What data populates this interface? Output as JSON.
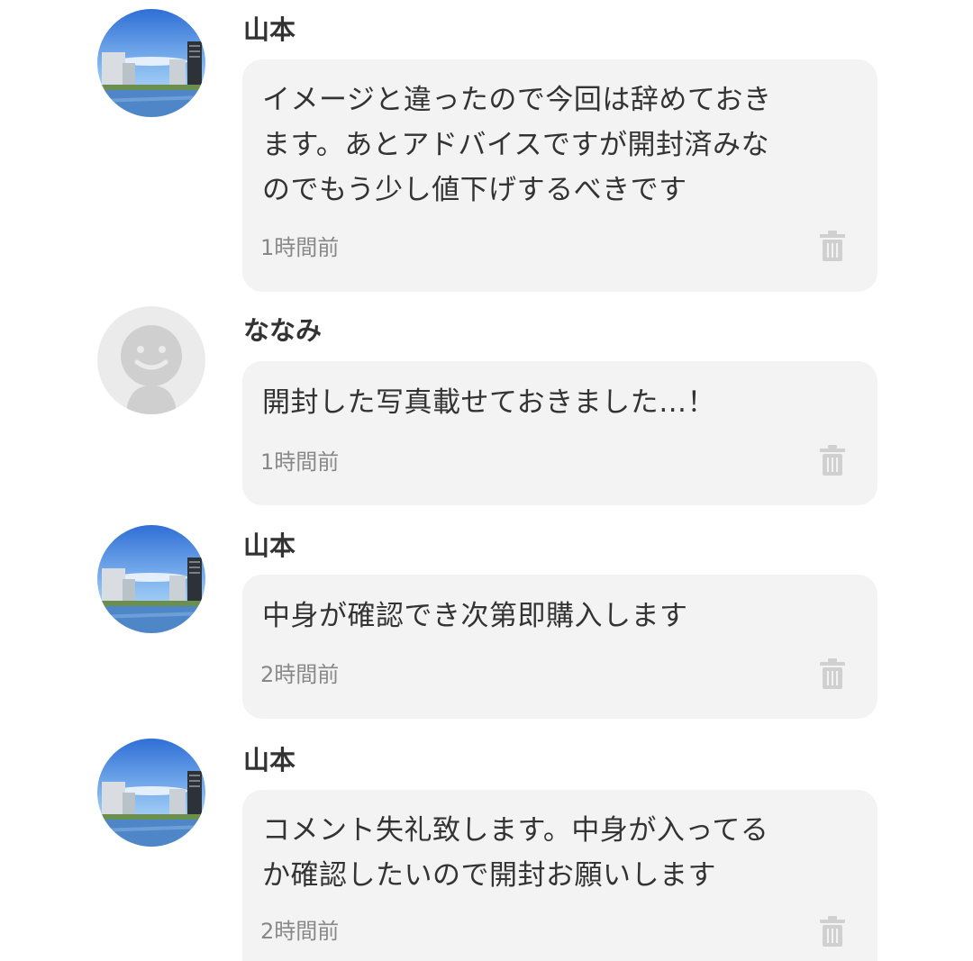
{
  "comments": [
    {
      "avatar": "city-river-photo",
      "author": "山本",
      "lines": [
        "イメージと違ったので今回は辞めておき",
        "ます。あとアドバイスですが開封済みな",
        "のでもう少し値下げするべきです"
      ],
      "time": "1時間前",
      "delete_icon": "trash-icon"
    },
    {
      "avatar": "default-smiley-avatar",
      "author": "ななみ",
      "lines": [
        "開封した写真載せておきました…！"
      ],
      "time": "1時間前",
      "delete_icon": "trash-icon"
    },
    {
      "avatar": "city-river-photo",
      "author": "山本",
      "lines": [
        "中身が確認でき次第即購入します"
      ],
      "time": "2時間前",
      "delete_icon": "trash-icon"
    },
    {
      "avatar": "city-river-photo",
      "author": "山本",
      "lines": [
        "コメント失礼致します。中身が入ってる",
        "か確認したいので開封お願いします"
      ],
      "time": "2時間前",
      "delete_icon": "trash-icon"
    }
  ],
  "colors": {
    "bubble_background": "#f3f3f3",
    "text": "#333333",
    "timestamp": "#888888",
    "trash_icon": "#d0d0d0"
  }
}
